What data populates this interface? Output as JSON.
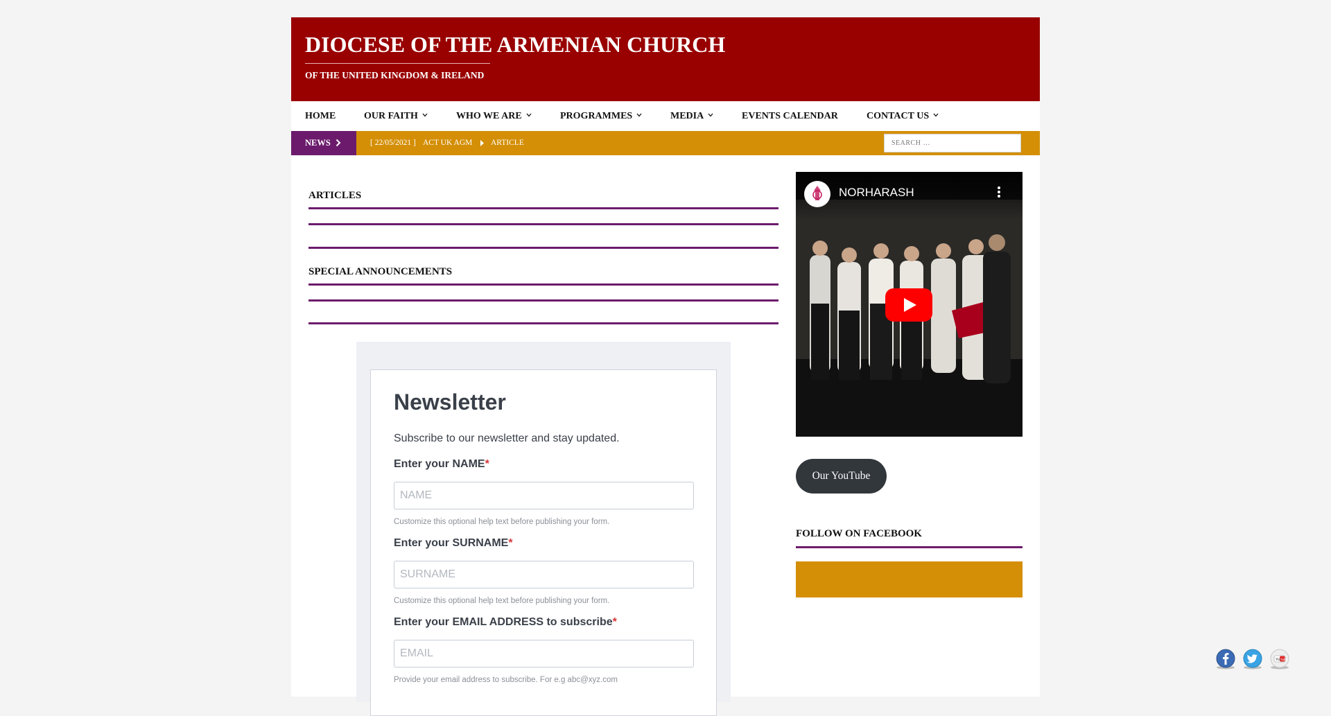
{
  "header": {
    "title": "DIOCESE OF THE ARMENIAN CHURCH",
    "subtitle": "OF THE UNITED KINGDOM & IRELAND"
  },
  "nav": {
    "items": [
      {
        "label": "HOME"
      },
      {
        "label": "OUR FAITH"
      },
      {
        "label": "WHO WE ARE"
      },
      {
        "label": "PROGRAMMES"
      },
      {
        "label": "MEDIA"
      },
      {
        "label": "EVENTS CALENDAR"
      },
      {
        "label": "CONTACT US"
      }
    ]
  },
  "ticker": {
    "label": "NEWS",
    "date": "[ 22/05/2021 ]",
    "headline": "ACT UK AGM",
    "category": "ARTICLE",
    "search_placeholder": "SEARCH …"
  },
  "main": {
    "articles_title": "ARTICLES",
    "announcements_title": "SPECIAL ANNOUNCEMENTS"
  },
  "newsletter": {
    "title": "Newsletter",
    "description": "Subscribe to our newsletter and stay updated.",
    "name_label": "Enter your NAME",
    "name_placeholder": "NAME",
    "name_help": "Customize this optional help text before publishing your form.",
    "surname_label": "Enter your SURNAME",
    "surname_placeholder": "SURNAME",
    "surname_help": "Customize this optional help text before publishing your form.",
    "email_label": "Enter your EMAIL ADDRESS to subscribe",
    "email_placeholder": "EMAIL",
    "email_help": "Provide your email address to subscribe. For e.g abc@xyz.com",
    "required_mark": "*"
  },
  "sidebar": {
    "video_title": "NORHARASH",
    "youtube_button": "Our YouTube",
    "facebook_title": "FOLLOW ON FACEBOOK"
  },
  "social": {
    "icons": [
      "facebook-icon",
      "twitter-icon",
      "youtube-icon"
    ]
  },
  "colors": {
    "header_red": "#990000",
    "purple": "#6c1b6c",
    "gold": "#d48f07"
  }
}
